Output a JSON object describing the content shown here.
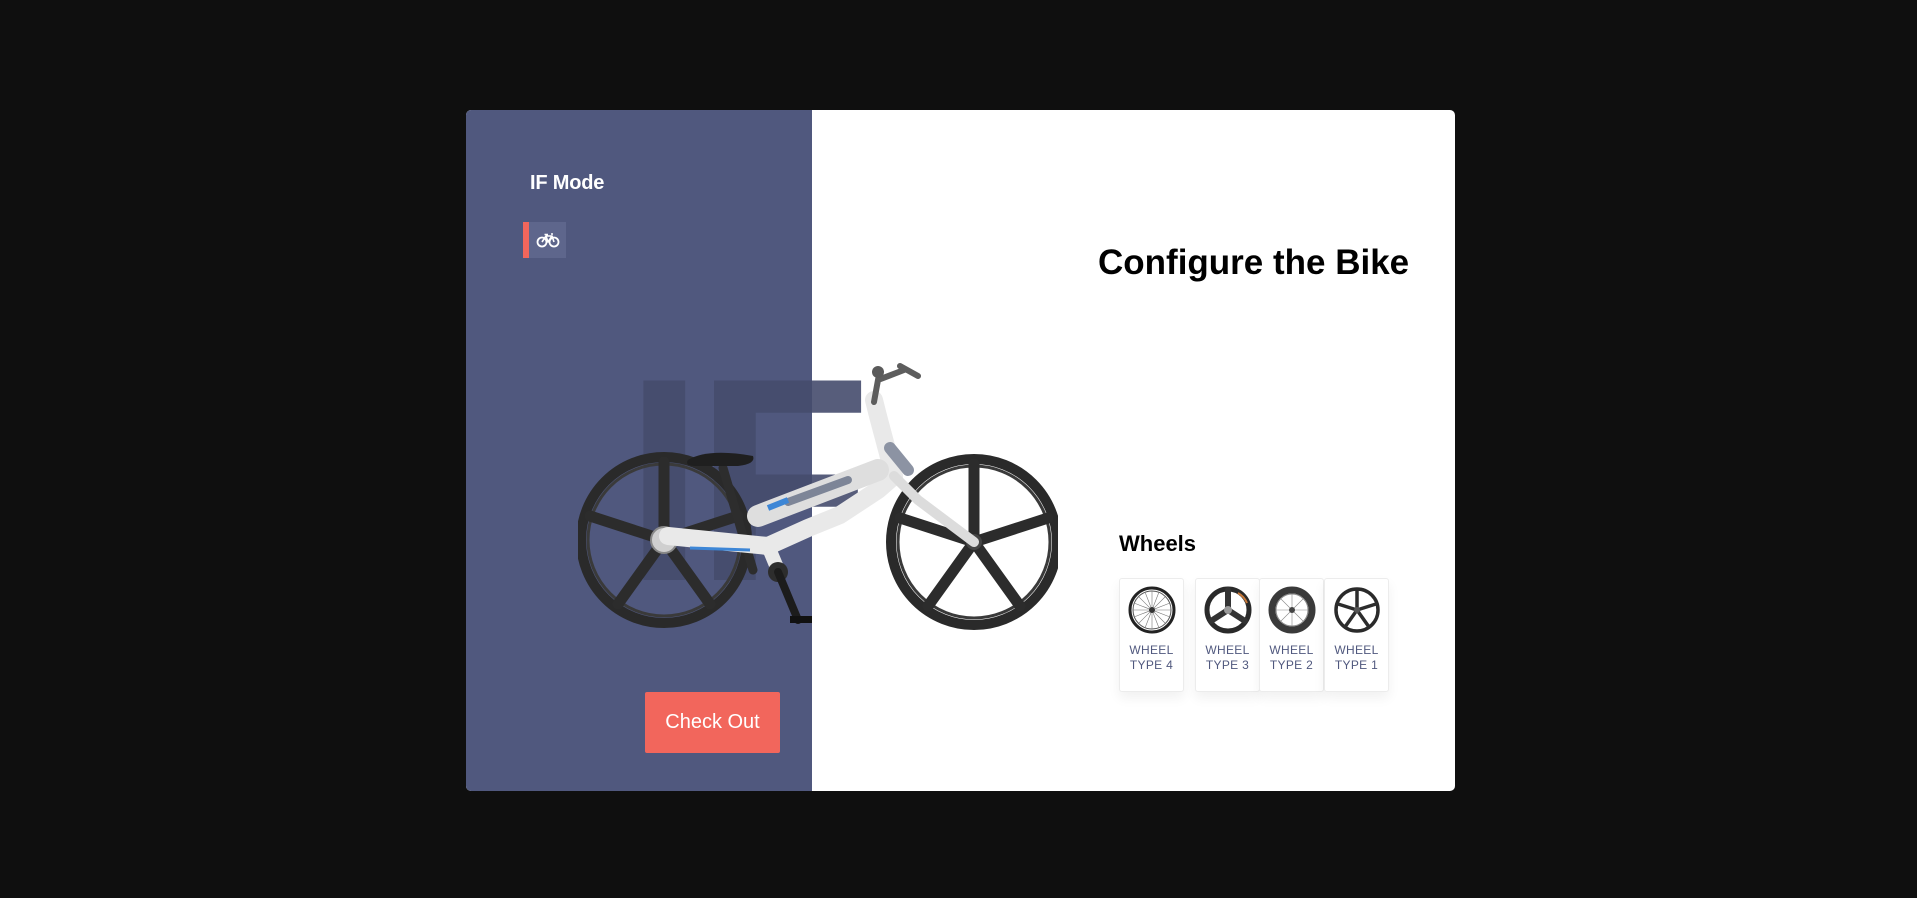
{
  "app": {
    "brand_title": "IF Mode",
    "mode_tab_icon": "bicycle-icon",
    "watermark": "IF"
  },
  "main": {
    "heading": "Configure the Bike",
    "checkout_label": "Check Out"
  },
  "wheels": {
    "title": "Wheels",
    "options": [
      {
        "label": "WHEEL TYPE 4",
        "icon": "spoked-wheel-icon"
      },
      {
        "label": "WHEEL TYPE 3",
        "icon": "tri-spoke-wheel-icon"
      },
      {
        "label": "WHEEL TYPE 2",
        "icon": "deep-rim-wheel-icon"
      },
      {
        "label": "WHEEL TYPE 1",
        "icon": "five-spoke-wheel-icon"
      }
    ]
  },
  "colors": {
    "accent": "#f2665c",
    "panel": "#50587e",
    "background": "#0f0f0f"
  }
}
